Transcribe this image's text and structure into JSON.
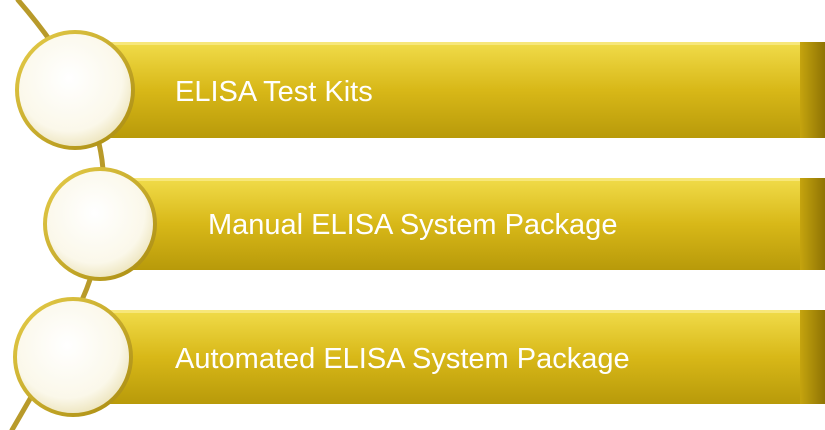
{
  "items": [
    {
      "label": "ELISA Test Kits"
    },
    {
      "label": "Manual ELISA System Package"
    },
    {
      "label": "Automated ELISA System Package"
    }
  ],
  "colors": {
    "bar_light": "#e8cf2e",
    "bar_mid": "#d2b214",
    "bar_dark": "#a88a06",
    "rim": "#c8aa22",
    "curve": "#b89a2a",
    "text": "#ffffff"
  }
}
